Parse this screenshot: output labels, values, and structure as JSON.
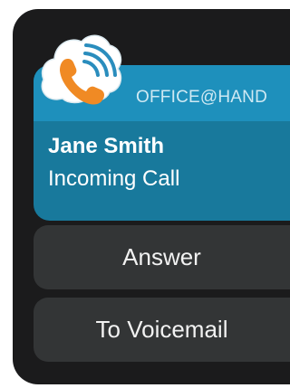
{
  "notification": {
    "app_name": "OFFICE@HAND",
    "caller_name": "Jane Smith",
    "call_status": "Incoming Call",
    "icon": "cloud-phone-icon"
  },
  "actions": {
    "answer_label": "Answer",
    "voicemail_label": "To Voicemail"
  },
  "colors": {
    "header_blue": "#1e90bc",
    "body_blue": "#18799c",
    "button_gray": "#333536",
    "frame_black": "#1b1b1c",
    "icon_orange": "#f08a24"
  }
}
